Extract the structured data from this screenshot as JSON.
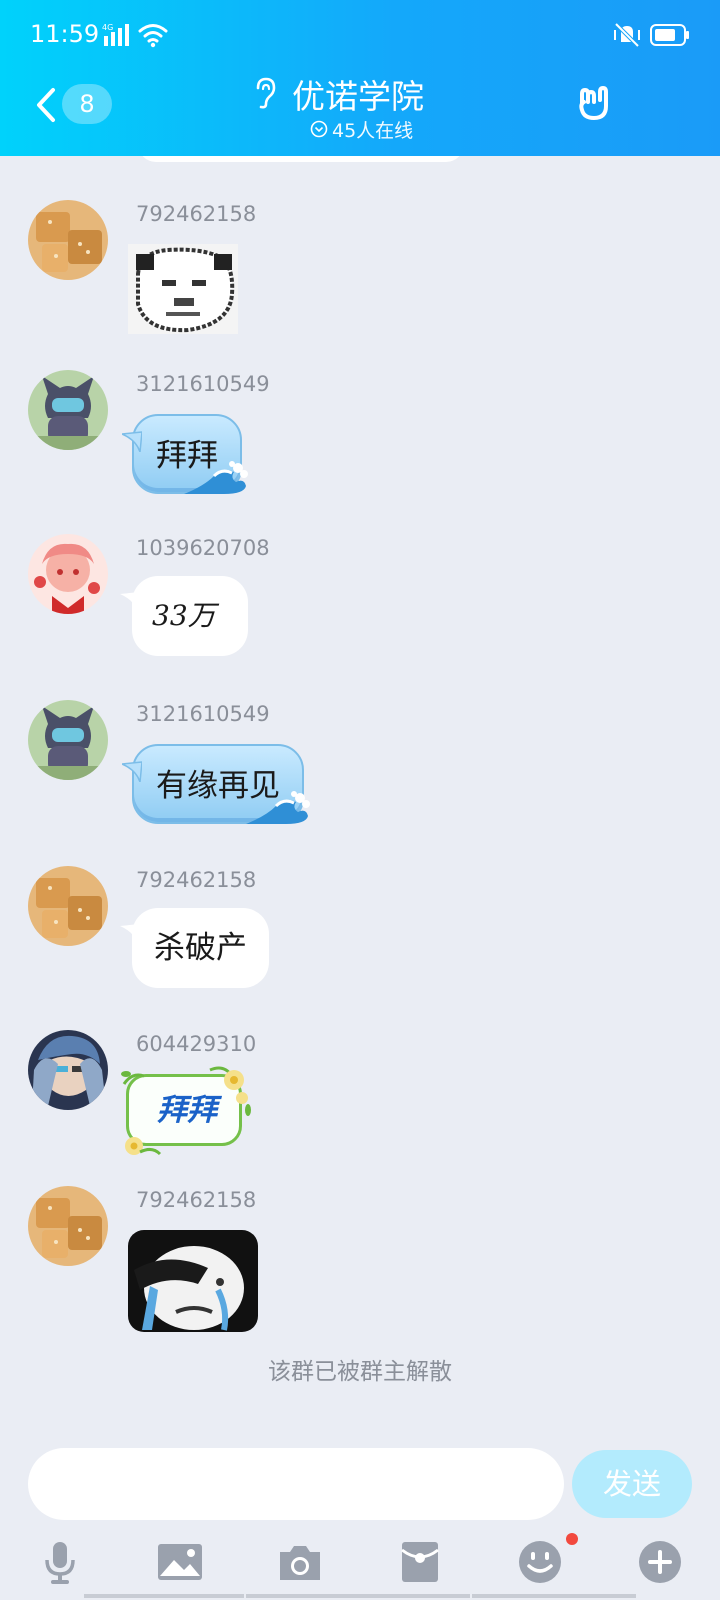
{
  "status_bar": {
    "time": "11:59",
    "network": "4G"
  },
  "header": {
    "back_badge": "8",
    "title": "优诺学院",
    "online": "45人在线"
  },
  "messages": [
    {
      "sender": "792462158",
      "type": "sticker",
      "sticker": "pixel-panda-face"
    },
    {
      "sender": "3121610549",
      "type": "text-blue",
      "text": "拜拜"
    },
    {
      "sender": "1039620708",
      "type": "text-handwritten",
      "text": "33万"
    },
    {
      "sender": "3121610549",
      "type": "text-blue",
      "text": "有缘再见"
    },
    {
      "sender": "792462158",
      "type": "text",
      "text": "杀破产"
    },
    {
      "sender": "604429310",
      "type": "text-flower",
      "text": "拜拜"
    },
    {
      "sender": "792462158",
      "type": "sticker",
      "sticker": "crying-panda-face"
    }
  ],
  "system_note": "该群已被群主解散",
  "input": {
    "placeholder": "",
    "send_label": "发送"
  },
  "toolbar_icons": [
    "microphone-icon",
    "image-icon",
    "camera-icon",
    "red-packet-icon",
    "emoji-icon",
    "plus-icon"
  ],
  "colors": {
    "header_start": "#00d2fb",
    "header_end": "#1a9bf8",
    "chat_bg": "#eaedf4",
    "send_disabled": "#b3ebfd",
    "notification_dot": "#f2493e"
  }
}
